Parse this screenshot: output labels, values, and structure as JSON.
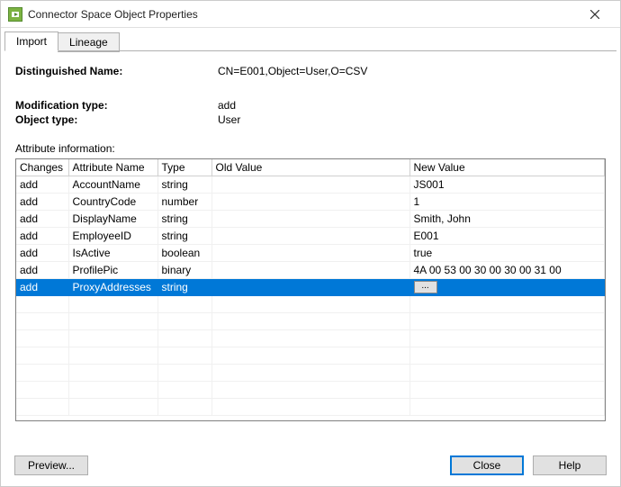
{
  "window": {
    "title": "Connector Space Object Properties"
  },
  "tabs": [
    {
      "label": "Import",
      "active": true
    },
    {
      "label": "Lineage",
      "active": false
    }
  ],
  "fields": {
    "dn_label": "Distinguished Name:",
    "dn_value": "CN=E001,Object=User,O=CSV",
    "modtype_label": "Modification type:",
    "modtype_value": "add",
    "objtype_label": "Object type:",
    "objtype_value": "User"
  },
  "attribute_section_label": "Attribute information:",
  "columns": {
    "changes": "Changes",
    "attr": "Attribute Name",
    "type": "Type",
    "old": "Old Value",
    "new": "New Value"
  },
  "rows": [
    {
      "changes": "add",
      "attr": "AccountName",
      "type": "string",
      "old": "",
      "new": "JS001"
    },
    {
      "changes": "add",
      "attr": "CountryCode",
      "type": "number",
      "old": "",
      "new": "1"
    },
    {
      "changes": "add",
      "attr": "DisplayName",
      "type": "string",
      "old": "",
      "new": "Smith, John"
    },
    {
      "changes": "add",
      "attr": "EmployeeID",
      "type": "string",
      "old": "",
      "new": "E001"
    },
    {
      "changes": "add",
      "attr": "IsActive",
      "type": "boolean",
      "old": "",
      "new": "true"
    },
    {
      "changes": "add",
      "attr": "ProfilePic",
      "type": "binary",
      "old": "",
      "new": "4A 00 53 00 30 00 30 00 31 00"
    },
    {
      "changes": "add",
      "attr": "ProxyAddresses",
      "type": "string",
      "old": "",
      "new": "",
      "selected": true,
      "ellipsis": true
    }
  ],
  "buttons": {
    "preview": "Preview...",
    "close": "Close",
    "help": "Help"
  }
}
